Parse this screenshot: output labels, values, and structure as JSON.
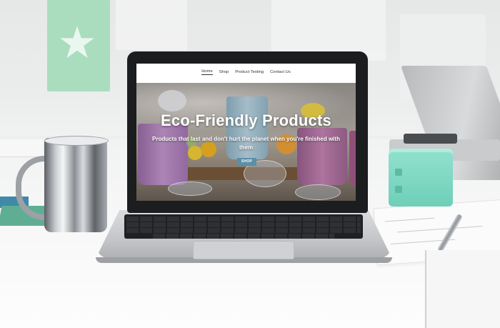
{
  "site": {
    "nav": [
      {
        "label": "Home",
        "active": true
      },
      {
        "label": "Shop",
        "active": false
      },
      {
        "label": "Product Testing",
        "active": false
      },
      {
        "label": "Contact Us",
        "active": false
      }
    ],
    "hero": {
      "title": "Eco-Friendly Products",
      "subtitle": "Products that last and don't hurt the planet when you're finished with them",
      "button_label": "SHOP"
    }
  },
  "icons": [
    "star-icon"
  ],
  "colors": {
    "shop_button": "#5a8fa8",
    "nav_text": "#333333",
    "hero_text": "#ffffff"
  }
}
